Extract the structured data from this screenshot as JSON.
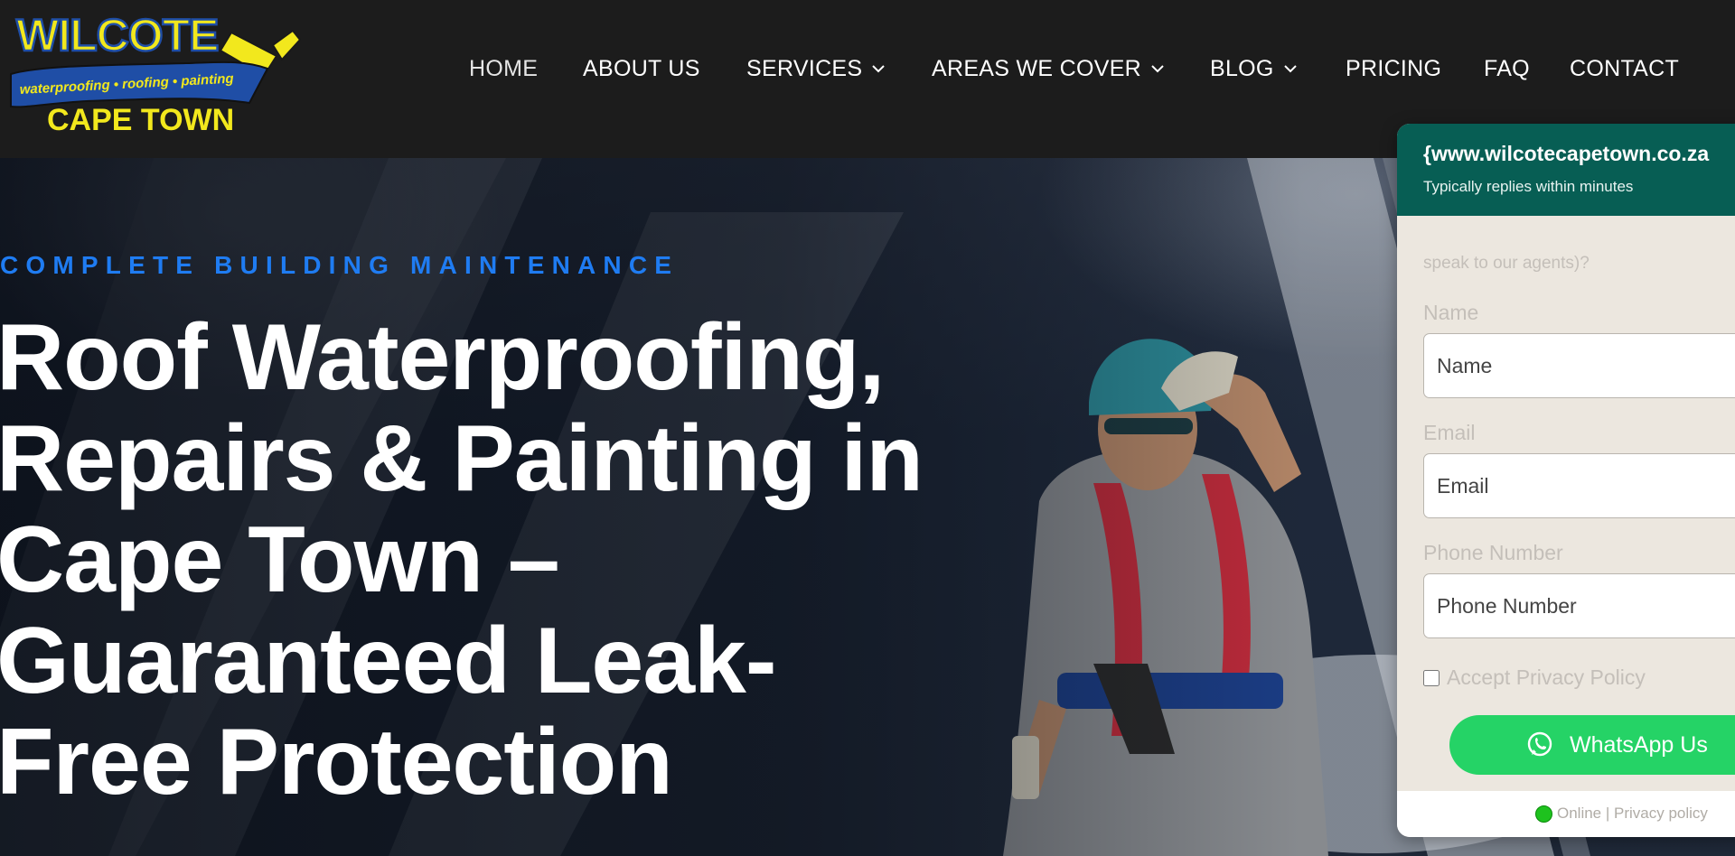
{
  "logo": {
    "brand": "WILCOTE",
    "tagline": "waterproofing • roofing • painting",
    "location": "CAPE TOWN"
  },
  "nav": {
    "items": [
      {
        "label": "HOME",
        "has_dropdown": false,
        "active": true
      },
      {
        "label": "ABOUT US",
        "has_dropdown": false
      },
      {
        "label": "SERVICES",
        "has_dropdown": true
      },
      {
        "label": "AREAS WE COVER",
        "has_dropdown": true
      },
      {
        "label": "BLOG",
        "has_dropdown": true
      },
      {
        "label": "PRICING",
        "has_dropdown": false
      },
      {
        "label": "FAQ",
        "has_dropdown": false
      },
      {
        "label": "CONTACT",
        "has_dropdown": false
      }
    ]
  },
  "hero": {
    "eyebrow": "COMPLETE BUILDING MAINTENANCE",
    "headline_lines": [
      "Roof Waterproofing,",
      "Repairs & Painting in",
      "Cape Town –",
      "Guaranteed Leak-",
      "Free Protection"
    ]
  },
  "widget": {
    "title": "{www.wilcotecapetown.co.za",
    "subtitle": "Typically replies within minutes",
    "intro": "speak to our agents)?",
    "name_label": "Name",
    "name_placeholder": "Name",
    "email_label": "Email",
    "email_placeholder": "Email",
    "phone_label": "Phone Number",
    "phone_placeholder": "Phone Number",
    "privacy_label": "Accept Privacy Policy",
    "button_label": "WhatsApp Us",
    "footer_text": "Online | Privacy policy"
  },
  "colors": {
    "header_bg": "#1c1c1c",
    "eyebrow": "#1f7cf2",
    "widget_header": "#075e54",
    "whatsapp_green": "#25d366",
    "logo_yellow": "#f2e81d",
    "logo_blue": "#1f4ea6"
  }
}
